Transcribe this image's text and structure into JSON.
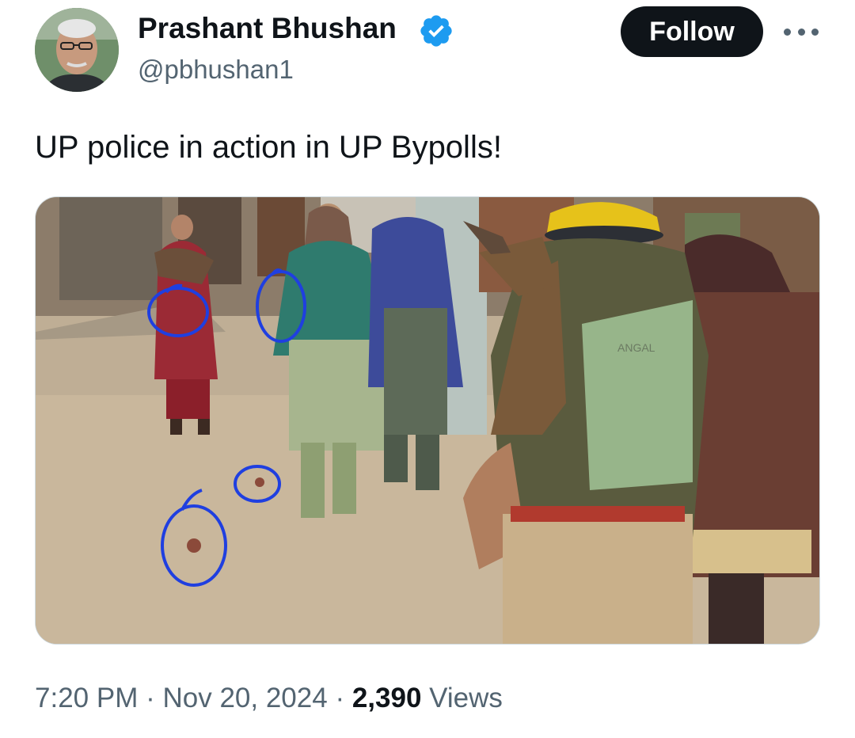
{
  "author": {
    "display_name": "Prashant Bhushan",
    "handle": "@pbhushan1",
    "verified": true,
    "verified_color": "#1d9bf0"
  },
  "actions": {
    "follow_label": "Follow",
    "more_icon": "ellipsis-icon"
  },
  "tweet": {
    "text": "UP police in action in UP Bypolls!"
  },
  "meta": {
    "time": "7:20 PM",
    "separator": "·",
    "date": "Nov 20, 2024",
    "views_count": "2,390",
    "views_label": "Views"
  },
  "media": {
    "uniform_text": "ANGAL"
  }
}
